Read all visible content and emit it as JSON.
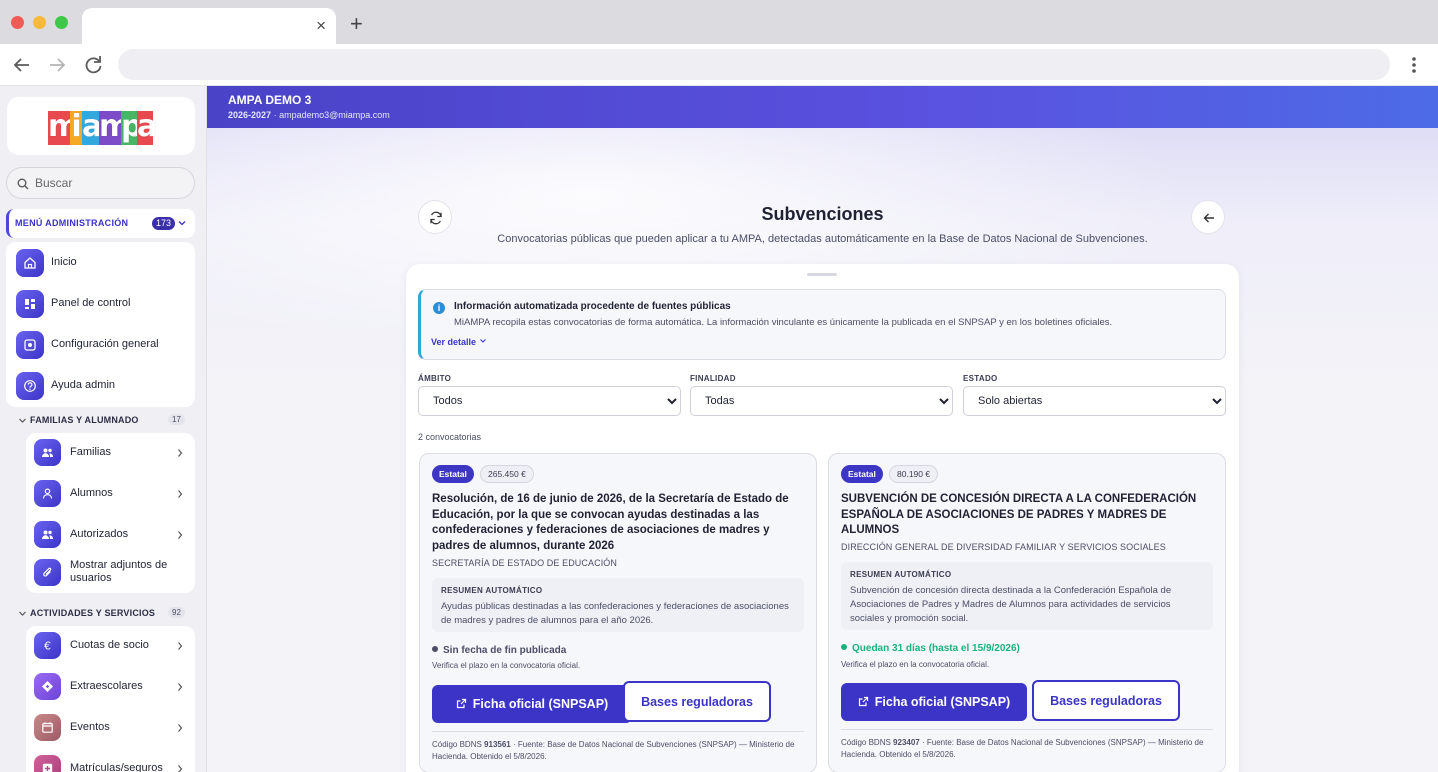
{
  "browser": {
    "tab_close": "×",
    "new_tab": "+"
  },
  "sidebar": {
    "search_placeholder": "Buscar",
    "admin_menu": {
      "label": "MENÚ ADMINISTRACIÓN",
      "count": "173"
    },
    "admin_items": [
      {
        "label": "Inicio",
        "icon": "home-icon"
      },
      {
        "label": "Panel de control",
        "icon": "dashboard-icon"
      },
      {
        "label": "Configuración general",
        "icon": "settings-icon"
      },
      {
        "label": "Ayuda admin",
        "icon": "help-icon"
      }
    ],
    "section_families": {
      "label": "FAMILIAS Y ALUMNADO",
      "count": "17"
    },
    "family_items": [
      {
        "label": "Familias",
        "icon": "users-icon"
      },
      {
        "label": "Alumnos",
        "icon": "user-icon"
      },
      {
        "label": "Autorizados",
        "icon": "users-icon"
      },
      {
        "label": "Mostrar adjuntos de usuarios",
        "icon": "paperclip-icon"
      }
    ],
    "section_activities": {
      "label": "ACTIVIDADES Y SERVICIOS",
      "count": "92"
    },
    "activity_items": [
      {
        "label": "Cuotas de socio",
        "icon": "euro-icon"
      },
      {
        "label": "Extraescolares",
        "icon": "diamond-icon"
      },
      {
        "label": "Eventos",
        "icon": "calendar-icon"
      },
      {
        "label": "Matrículas/seguros",
        "icon": "plus-box-icon"
      }
    ]
  },
  "header": {
    "org_name": "AMPA DEMO 3",
    "year": "2026-2027",
    "separator": "·",
    "email": "ampademo3@miampa.com"
  },
  "page": {
    "title": "Subvenciones",
    "subtitle": "Convocatorias públicas que pueden aplicar a tu AMPA, detectadas automáticamente en la Base de Datos Nacional de Subvenciones."
  },
  "info": {
    "icon_glyph": "i",
    "title": "Información automatizada procedente de fuentes públicas",
    "text": "MiAMPA recopila estas convocatorias de forma automática. La información vinculante es únicamente la publicada en el SNPSAP y en los boletines oficiales.",
    "link": "Ver detalle"
  },
  "filters": {
    "ambito": {
      "label": "ÁMBITO",
      "value": "Todos"
    },
    "finalidad": {
      "label": "FINALIDAD",
      "value": "Todas"
    },
    "estado": {
      "label": "ESTADO",
      "value": "Solo abiertas"
    }
  },
  "results_count": "2 convocatorias",
  "grants": [
    {
      "scope": "Estatal",
      "amount": "265.450 €",
      "title": "Resolución, de 16 de junio de 2026, de la Secretaría de Estado de Educación, por la que se convocan ayudas destinadas a las confederaciones y federaciones de asociaciones de madres y padres de alumnos, durante 2026",
      "organism": "SECRETARÍA DE ESTADO DE EDUCACIÓN",
      "summary_label": "RESUMEN AUTOMÁTICO",
      "summary": "Ayudas públicas destinadas a las confederaciones y federaciones de asociaciones de madres y padres de alumnos para el año 2026.",
      "deadline": "Sin fecha de fin publicada",
      "deadline_color": "#4b4e66",
      "verify": "Verifica el plazo en la convocatoria oficial.",
      "btn_official": "Ficha oficial (SNPSAP)",
      "btn_rules": "Bases reguladoras",
      "footer_prefix": "Código BDNS",
      "code": "913561",
      "footer_source": "· Fuente: Base de Datos Nacional de Subvenciones (SNPSAP) — Ministerio de Hacienda. Obtenido el 5/8/2026."
    },
    {
      "scope": "Estatal",
      "amount": "80.190 €",
      "title": "SUBVENCIÓN DE CONCESIÓN DIRECTA A LA CONFEDERACIÓN ESPAÑOLA DE ASOCIACIONES DE PADRES Y MADRES DE ALUMNOS",
      "organism": "DIRECCIÓN GENERAL DE DIVERSIDAD FAMILIAR Y SERVICIOS SOCIALES",
      "summary_label": "RESUMEN AUTOMÁTICO",
      "summary": "Subvención de concesión directa destinada a la Confederación Española de Asociaciones de Padres y Madres de Alumnos para actividades de servicios sociales y promoción social.",
      "deadline": "Quedan 31 días (hasta el 15/9/2026)",
      "deadline_color": "#19b27a",
      "verify": "Verifica el plazo en la convocatoria oficial.",
      "btn_official": "Ficha oficial (SNPSAP)",
      "btn_rules": "Bases reguladoras",
      "footer_prefix": "Código BDNS",
      "code": "923407",
      "footer_source": "· Fuente: Base de Datos Nacional de Subvenciones (SNPSAP) — Ministerio de Hacienda. Obtenido el 5/8/2026."
    }
  ],
  "colors": {
    "accent": "#3b34c7",
    "header_gradient_start": "#4a43c7",
    "info_border": "#2ea7db",
    "open_status": "#19b27a"
  },
  "logo": {
    "letters": [
      "m",
      "i",
      "a",
      "m",
      "p",
      "a"
    ]
  }
}
